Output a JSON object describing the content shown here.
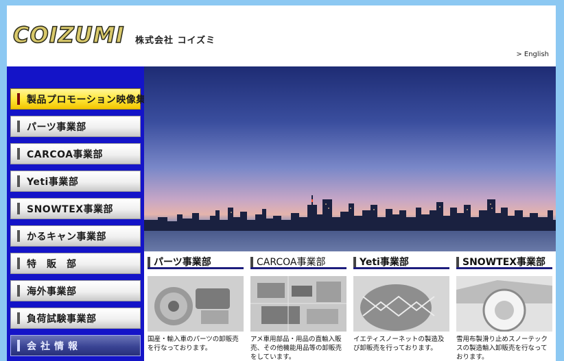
{
  "header": {
    "logo_text": "COIZUMI",
    "company_name": "株式会社 コイズミ",
    "lang_link": "> English"
  },
  "sidebar": {
    "items": [
      {
        "label": "製品プロモーション映像集",
        "style": "yellow"
      },
      {
        "label": "パーツ事業部",
        "style": "normal"
      },
      {
        "label": "CARCOA事業部",
        "style": "normal"
      },
      {
        "label": "Yeti事業部",
        "style": "normal"
      },
      {
        "label": "SNOWTEX事業部",
        "style": "normal"
      },
      {
        "label": "かるキャン事業部",
        "style": "normal"
      },
      {
        "label": "特　販　部",
        "style": "normal"
      },
      {
        "label": "海外事業部",
        "style": "normal"
      },
      {
        "label": "負荷試験事業部",
        "style": "normal"
      },
      {
        "label": "会社情報",
        "style": "dark"
      }
    ]
  },
  "departments": [
    {
      "title": "パーツ事業部",
      "description": "国産・輸入車のパーツの卸販売を行なっております。"
    },
    {
      "title": "CARCOA事業部",
      "description": "アメ車用部品・用品の直輸入販売、その他機能用品等の卸販売をしています。"
    },
    {
      "title": "Yeti事業部",
      "description": "イエティスノーネットの製造及び卸販売を行っております。"
    },
    {
      "title": "SNOWTEX事業部",
      "description": "雪用布製滑り止めスノーテックスの製造輸入卸販売を行なっております。"
    }
  ],
  "colors": {
    "page_bg": "#8cc8f2",
    "sidebar_bg": "#1414c8",
    "accent_yellow": "#ffe83a",
    "rule_navy": "#1c1c7c"
  }
}
